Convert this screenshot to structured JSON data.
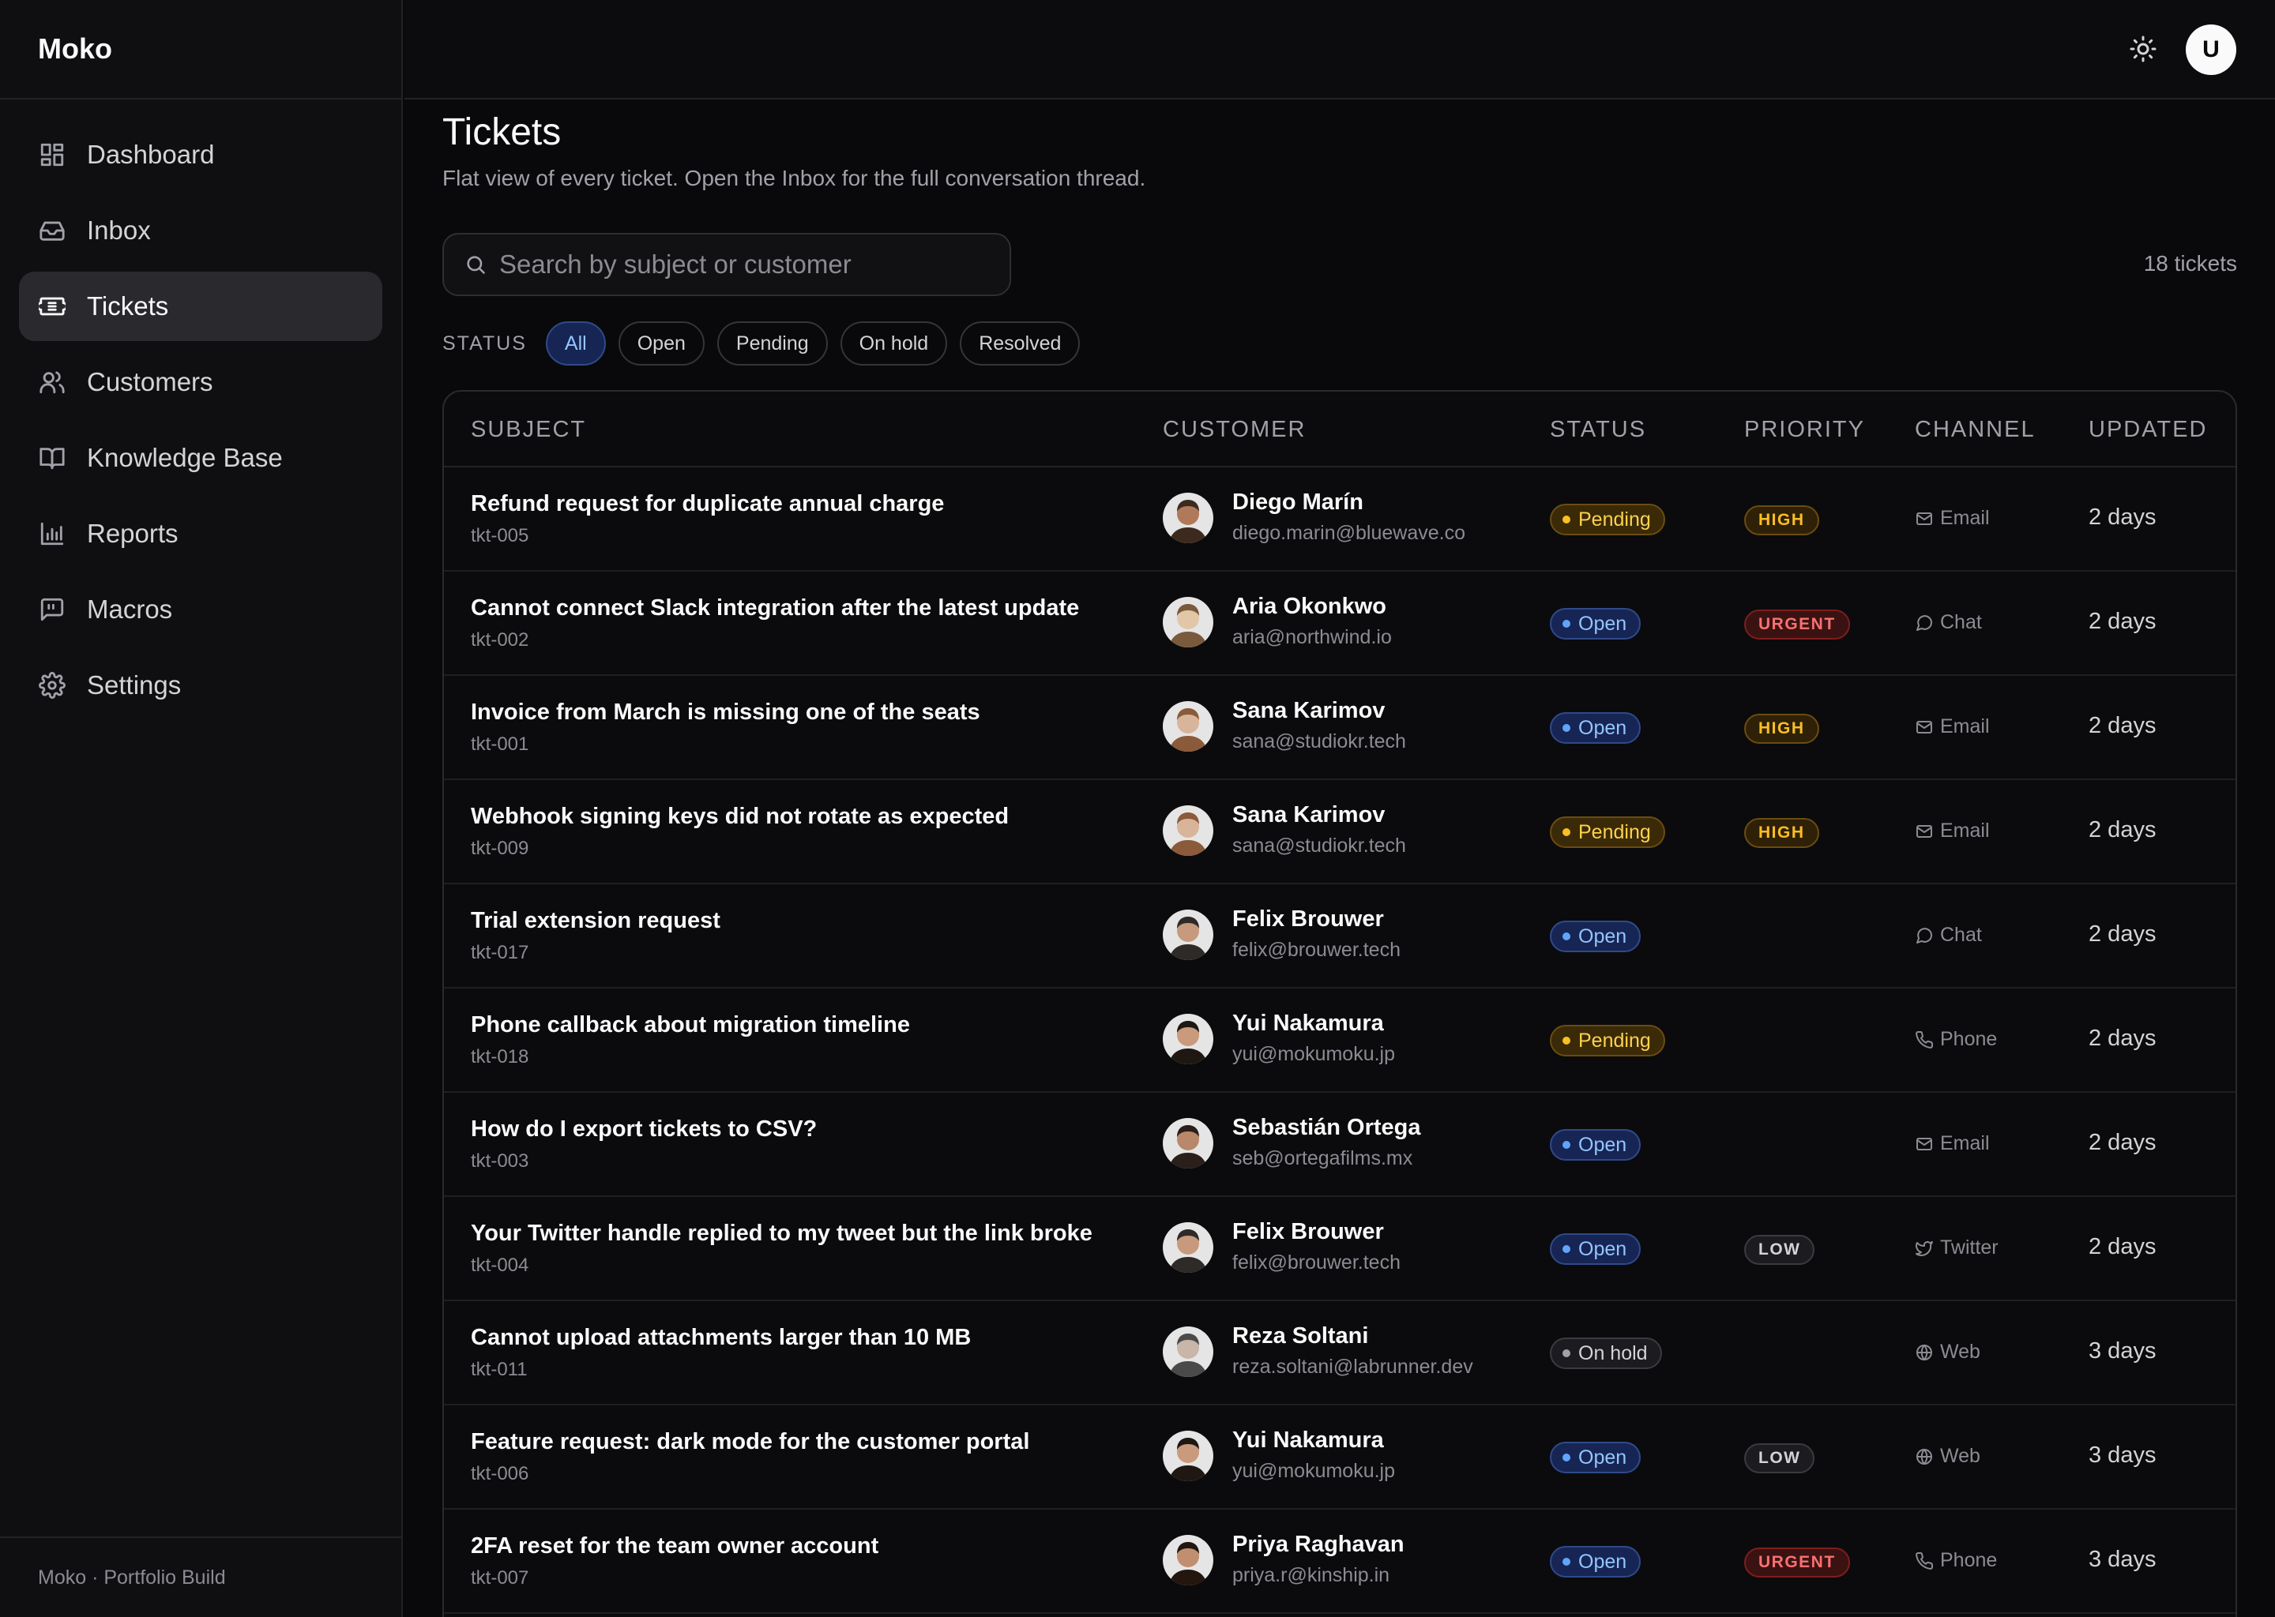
{
  "app": {
    "brand": "Moko",
    "footer": "Moko · Portfolio Build"
  },
  "topbar": {
    "avatar_initial": "U",
    "theme_icon": "sun-icon"
  },
  "sidebar": {
    "items": [
      {
        "label": "Dashboard",
        "icon": "dashboard-icon"
      },
      {
        "label": "Inbox",
        "icon": "inbox-icon"
      },
      {
        "label": "Tickets",
        "icon": "ticket-icon",
        "active": true
      },
      {
        "label": "Customers",
        "icon": "users-icon"
      },
      {
        "label": "Knowledge Base",
        "icon": "book-icon"
      },
      {
        "label": "Reports",
        "icon": "bar-chart-icon"
      },
      {
        "label": "Macros",
        "icon": "message-square-icon"
      },
      {
        "label": "Settings",
        "icon": "gear-icon"
      }
    ]
  },
  "page": {
    "title": "Tickets",
    "subtitle": "Flat view of every ticket. Open the Inbox for the full conversation thread.",
    "search_placeholder": "Search by subject or customer",
    "ticket_count": "18 tickets"
  },
  "filters": {
    "label": "STATUS",
    "options": [
      "All",
      "Open",
      "Pending",
      "On hold",
      "Resolved"
    ],
    "selected": "All"
  },
  "table": {
    "columns": [
      "SUBJECT",
      "CUSTOMER",
      "STATUS",
      "PRIORITY",
      "CHANNEL",
      "UPDATED"
    ],
    "rows": [
      {
        "subject": "Refund request for duplicate annual charge",
        "id": "tkt-005",
        "customer": "Diego Marín",
        "email": "diego.marin@bluewave.co",
        "status": "Pending",
        "priority": "HIGH",
        "channel": "Email",
        "updated": "2 days"
      },
      {
        "subject": "Cannot connect Slack integration after the latest update",
        "id": "tkt-002",
        "customer": "Aria Okonkwo",
        "email": "aria@northwind.io",
        "status": "Open",
        "priority": "URGENT",
        "channel": "Chat",
        "updated": "2 days"
      },
      {
        "subject": "Invoice from March is missing one of the seats",
        "id": "tkt-001",
        "customer": "Sana Karimov",
        "email": "sana@studiokr.tech",
        "status": "Open",
        "priority": "HIGH",
        "channel": "Email",
        "updated": "2 days"
      },
      {
        "subject": "Webhook signing keys did not rotate as expected",
        "id": "tkt-009",
        "customer": "Sana Karimov",
        "email": "sana@studiokr.tech",
        "status": "Pending",
        "priority": "HIGH",
        "channel": "Email",
        "updated": "2 days"
      },
      {
        "subject": "Trial extension request",
        "id": "tkt-017",
        "customer": "Felix Brouwer",
        "email": "felix@brouwer.tech",
        "status": "Open",
        "priority": "",
        "channel": "Chat",
        "updated": "2 days"
      },
      {
        "subject": "Phone callback about migration timeline",
        "id": "tkt-018",
        "customer": "Yui Nakamura",
        "email": "yui@mokumoku.jp",
        "status": "Pending",
        "priority": "",
        "channel": "Phone",
        "updated": "2 days"
      },
      {
        "subject": "How do I export tickets to CSV?",
        "id": "tkt-003",
        "customer": "Sebastián Ortega",
        "email": "seb@ortegafilms.mx",
        "status": "Open",
        "priority": "",
        "channel": "Email",
        "updated": "2 days"
      },
      {
        "subject": "Your Twitter handle replied to my tweet but the link broke",
        "id": "tkt-004",
        "customer": "Felix Brouwer",
        "email": "felix@brouwer.tech",
        "status": "Open",
        "priority": "LOW",
        "channel": "Twitter",
        "updated": "2 days"
      },
      {
        "subject": "Cannot upload attachments larger than 10 MB",
        "id": "tkt-011",
        "customer": "Reza Soltani",
        "email": "reza.soltani@labrunner.dev",
        "status": "On hold",
        "priority": "",
        "channel": "Web",
        "updated": "3 days"
      },
      {
        "subject": "Feature request: dark mode for the customer portal",
        "id": "tkt-006",
        "customer": "Yui Nakamura",
        "email": "yui@mokumoku.jp",
        "status": "Open",
        "priority": "LOW",
        "channel": "Web",
        "updated": "3 days"
      },
      {
        "subject": "2FA reset for the team owner account",
        "id": "tkt-007",
        "customer": "Priya Raghavan",
        "email": "priya.r@kinship.in",
        "status": "Open",
        "priority": "URGENT",
        "channel": "Phone",
        "updated": "3 days"
      }
    ]
  },
  "colors": {
    "status": {
      "Open": "#60a5fa",
      "Pending": "#fbbf24",
      "On hold": "#a1a1aa"
    },
    "priority": {
      "HIGH": "#fbbf24",
      "URGENT": "#f87171",
      "LOW": "#a1a1aa"
    }
  }
}
